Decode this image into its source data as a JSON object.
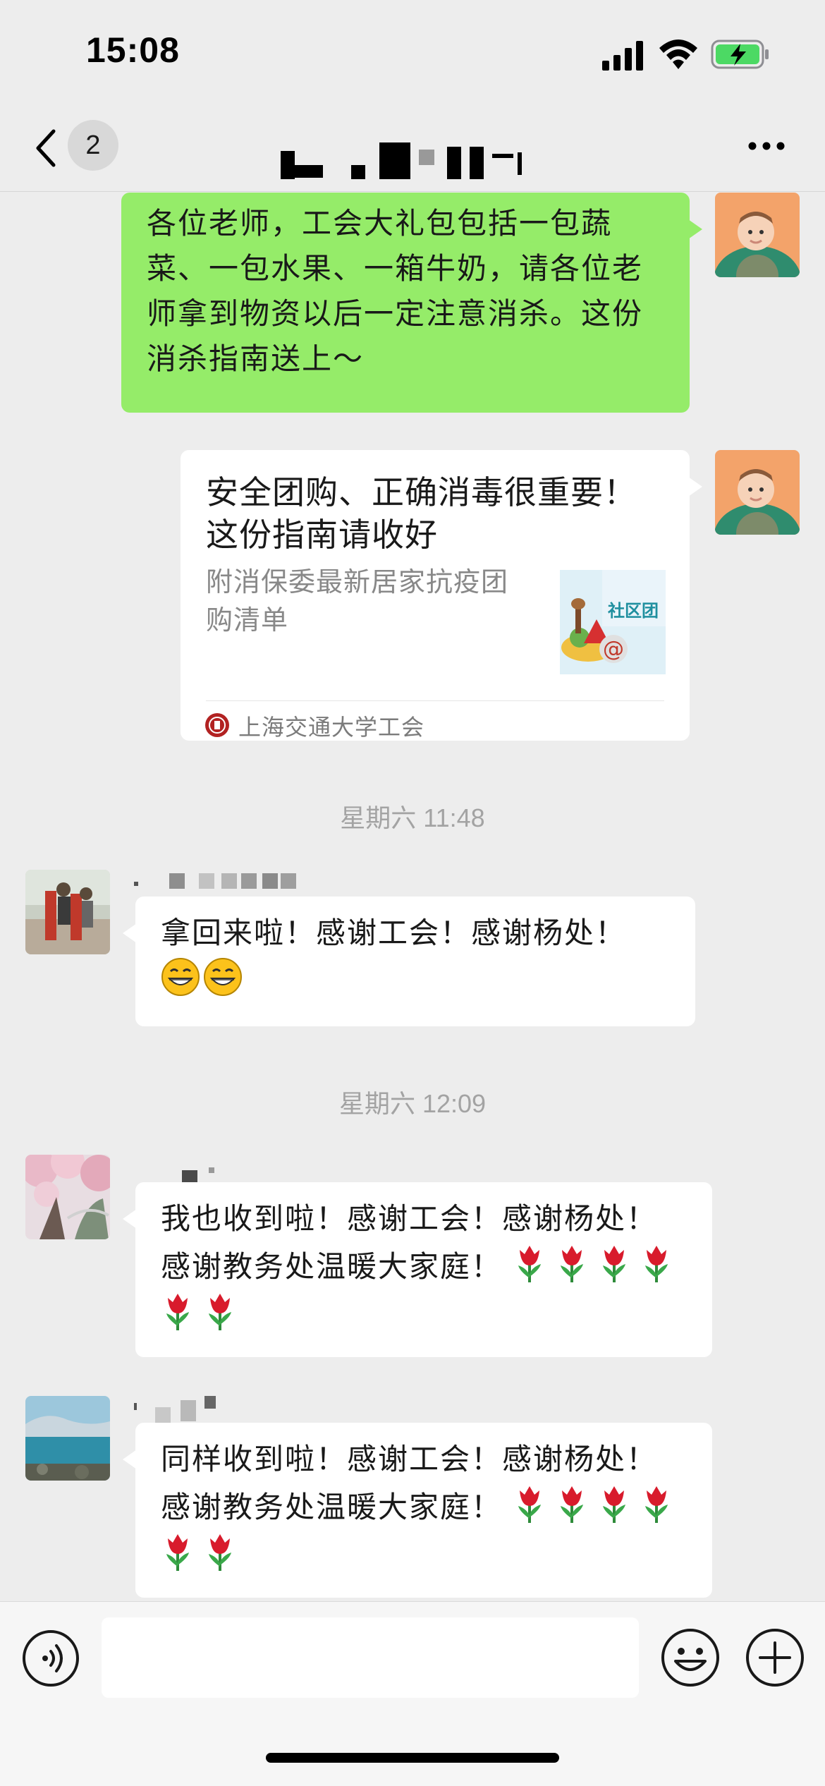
{
  "status_bar": {
    "time": "15:08"
  },
  "nav": {
    "unread_count": "2"
  },
  "messages": {
    "m1": {
      "text": "各位老师，工会大礼包包括一包蔬菜、一包水果、一箱牛奶，请各位老师拿到物资以后一定注意消杀。这份消杀指南送上～"
    },
    "m2": {
      "title": "安全团购、正确消毒很重要！这份指南请收好",
      "description": "附消保委最新居家抗疫团购清单",
      "thumbnail_text": "社区团",
      "source": "上海交通大学工会"
    },
    "ts1": "星期六 11:48",
    "m3": {
      "text": "拿回来啦！感谢工会！感谢杨处！",
      "emoji": "grinning-face x2"
    },
    "ts2": "星期六 12:09",
    "m4": {
      "text": "我也收到啦！感谢工会！感谢杨处！感谢教务处温暖大家庭！",
      "emoji": "tulip x6"
    },
    "m5": {
      "text": "同样收到啦！感谢工会！感谢杨处！感谢教务处温暖大家庭！",
      "emoji": "tulip x6"
    }
  },
  "input": {
    "placeholder": ""
  },
  "icons": {
    "back": "chevron-left-icon",
    "more": "more-dots-icon",
    "voice": "voice-icon",
    "emoji": "smiley-icon",
    "plus": "plus-icon"
  },
  "colors": {
    "background": "#ededed",
    "self_bubble": "#95ec69",
    "other_bubble": "#ffffff",
    "timestamp": "#a3a3a3",
    "battery": "#4cd964"
  }
}
